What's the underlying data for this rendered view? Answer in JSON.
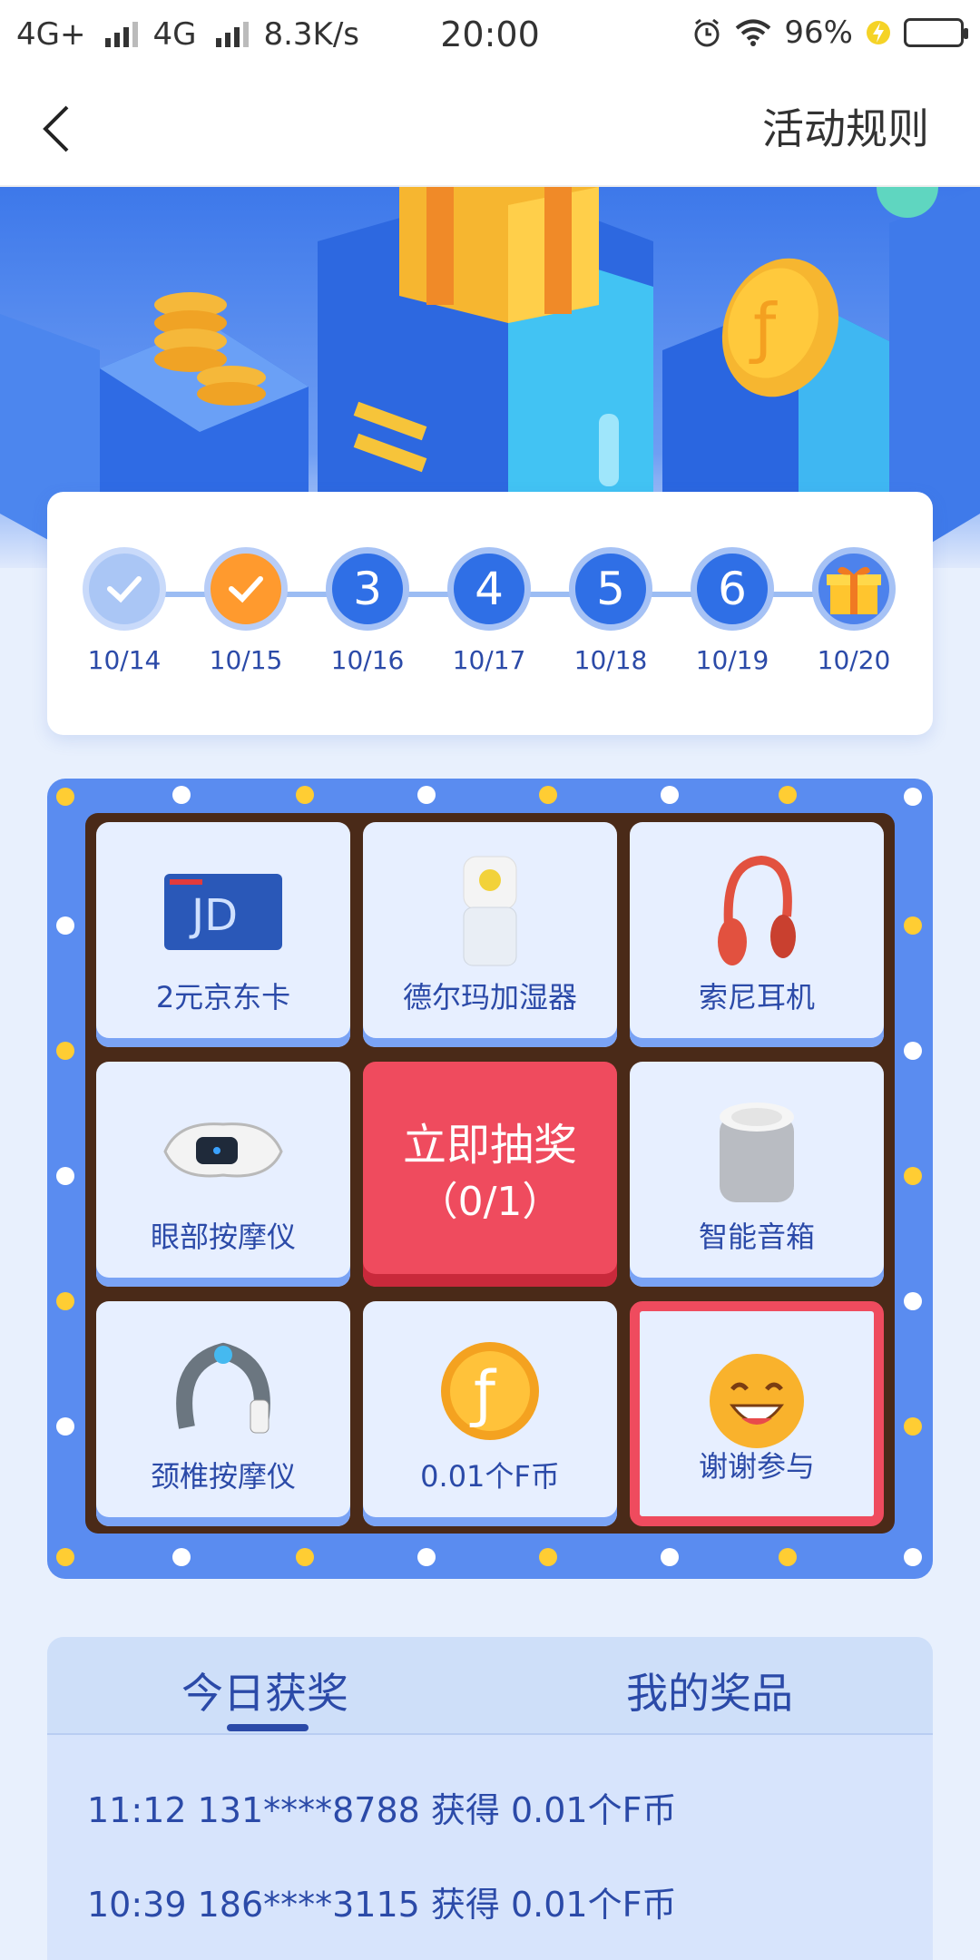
{
  "status_bar": {
    "net1": "4G+",
    "net2": "4G",
    "speed": "8.3K/s",
    "time": "20:00",
    "battery": "96%"
  },
  "nav": {
    "back_icon": "chevron-left-icon",
    "rules": "活动规则"
  },
  "check_in": {
    "days": [
      {
        "status": "done",
        "label": "",
        "date": "10/14"
      },
      {
        "status": "today",
        "label": "",
        "date": "10/15"
      },
      {
        "status": "future",
        "label": "3",
        "date": "10/16"
      },
      {
        "status": "future",
        "label": "4",
        "date": "10/17"
      },
      {
        "status": "future",
        "label": "5",
        "date": "10/18"
      },
      {
        "status": "future",
        "label": "6",
        "date": "10/19"
      },
      {
        "status": "gift",
        "label": "",
        "date": "10/20"
      }
    ]
  },
  "lottery": {
    "prizes": [
      {
        "label": "2元京东卡",
        "icon": "jd-card-icon"
      },
      {
        "label": "德尔玛加湿器",
        "icon": "humidifier-icon"
      },
      {
        "label": "索尼耳机",
        "icon": "headphones-icon"
      },
      {
        "label": "眼部按摩仪",
        "icon": "eye-massager-icon"
      },
      {
        "label": "智能音箱",
        "icon": "smart-speaker-icon"
      },
      {
        "label": "颈椎按摩仪",
        "icon": "neck-massager-icon"
      },
      {
        "label": "0.01个F币",
        "icon": "f-coin-icon"
      },
      {
        "label": "谢谢参与",
        "icon": "smile-emoji-icon"
      }
    ],
    "draw_button": "立即抽奖",
    "draw_count": "（0/1）"
  },
  "tabs": {
    "today": "今日获奖",
    "mine": "我的奖品"
  },
  "records": [
    "11:12 131****8788 获得 0.01个F币",
    "10:39 186****3115 获得 0.01个F币"
  ]
}
